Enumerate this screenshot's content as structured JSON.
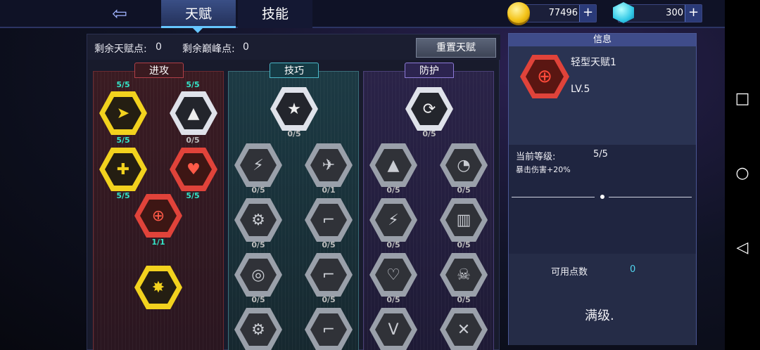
{
  "header": {
    "tabs": [
      {
        "label": "天赋"
      },
      {
        "label": "技能"
      }
    ],
    "gold": "77496",
    "gems": "300",
    "plus": "+"
  },
  "points": {
    "talent_label": "剩余天赋点:",
    "talent_value": "0",
    "peak_label": "剩余巅峰点:",
    "peak_value": "0",
    "reset": "重置天赋"
  },
  "trees": {
    "attack": {
      "title": "进攻",
      "levels": [
        "5/5",
        "5/5",
        "5/5",
        "0/5",
        "5/5",
        "5/5",
        "1/1"
      ]
    },
    "skill": {
      "title": "技巧",
      "levels": [
        "0/5",
        "0/5",
        "0/1",
        "0/5",
        "0/5",
        "0/5",
        "0/5"
      ]
    },
    "defense": {
      "title": "防护",
      "levels": [
        "0/5",
        "0/5",
        "0/5",
        "0/5",
        "0/5",
        "0/5",
        "0/5"
      ]
    }
  },
  "info": {
    "header": "信息",
    "name": "轻型天赋1",
    "lv": "LV.5",
    "current_label": "当前等级:",
    "current_value": "5/5",
    "effect": "暴击伤害+20%",
    "available_label": "可用点数",
    "available_value": "0",
    "status": "满级."
  },
  "icons": [
    "back-arrow-icon",
    "coin-icon",
    "gem-icon",
    "plus-icon",
    "square-icon",
    "circle-icon",
    "triangle-back-icon"
  ],
  "colors": {
    "accent": "#66c6ff",
    "full_level": "#34e6c9",
    "yellow_node": "#f2d21e",
    "red_node": "#e0433a"
  }
}
